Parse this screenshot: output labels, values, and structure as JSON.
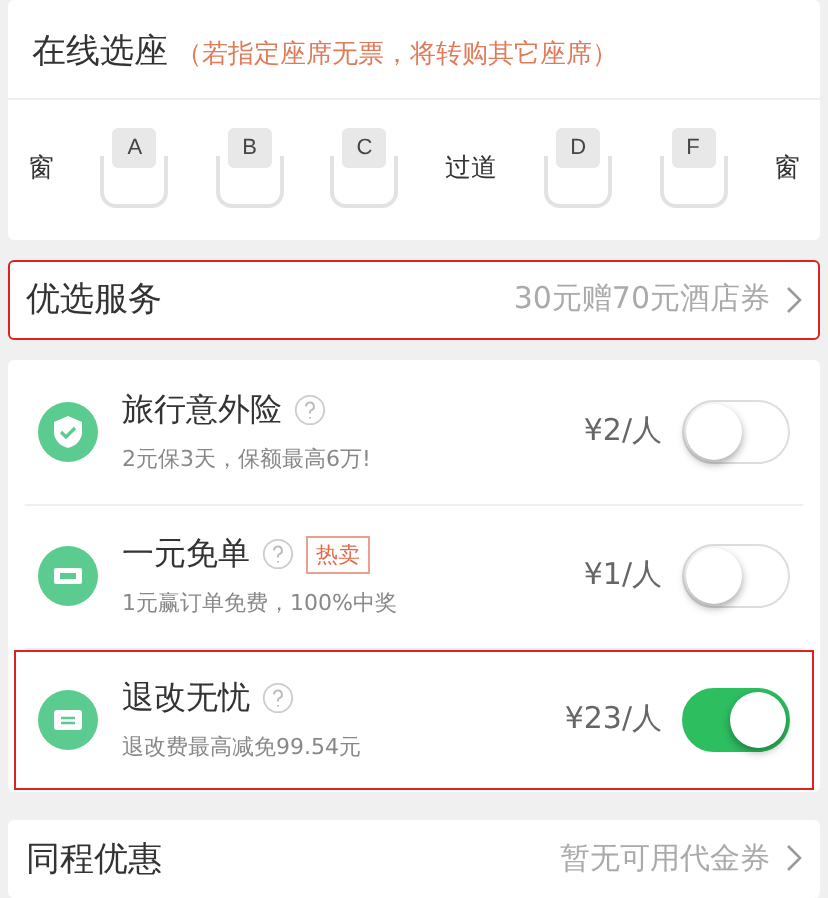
{
  "seat_selection": {
    "title": "在线选座",
    "note": "（若指定座席无票，将转购其它座席）",
    "seats": [
      {
        "kind": "label",
        "text": "窗"
      },
      {
        "kind": "seat",
        "text": "A"
      },
      {
        "kind": "seat",
        "text": "B"
      },
      {
        "kind": "seat",
        "text": "C"
      },
      {
        "kind": "label",
        "text": "过道"
      },
      {
        "kind": "seat",
        "text": "D"
      },
      {
        "kind": "seat",
        "text": "F"
      },
      {
        "kind": "label",
        "text": "窗"
      }
    ]
  },
  "preferred_service": {
    "title": "优选服务",
    "value": "30元赠70元酒店券",
    "highlighted": true
  },
  "services": [
    {
      "title": "旅行意外险",
      "subtitle": "2元保3天，保额最高6万!",
      "price": "¥2/人",
      "on": false,
      "highlighted": false
    },
    {
      "title": "一元免单",
      "tag": "热卖",
      "subtitle": "1元赢订单免费，100%中奖",
      "price": "¥1/人",
      "on": false,
      "highlighted": false
    },
    {
      "title": "退改无忧",
      "subtitle": "退改费最高减免99.54元",
      "price": "¥23/人",
      "on": true,
      "highlighted": true
    }
  ],
  "discount": {
    "title": "同程优惠",
    "value": "暂无可用代金券"
  }
}
